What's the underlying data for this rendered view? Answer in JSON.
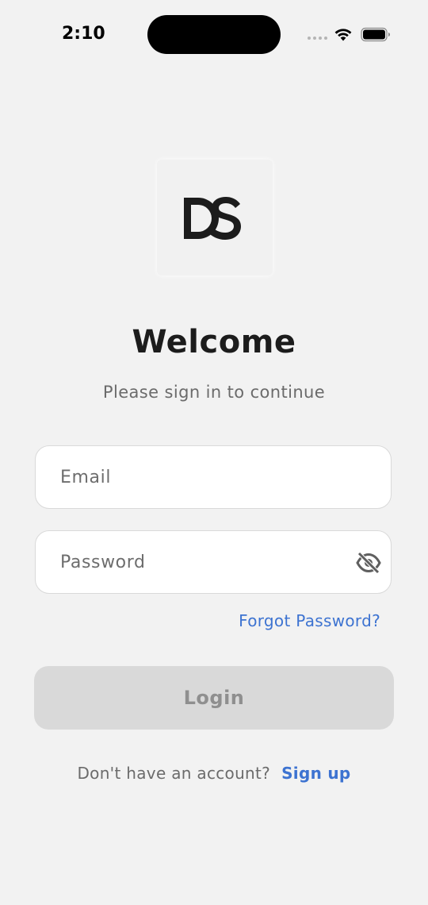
{
  "status_bar": {
    "time": "2:10"
  },
  "icons": {
    "signal": "cellular-signal-icon",
    "wifi": "wifi-icon",
    "battery": "battery-icon",
    "password_toggle": "eye-off-icon"
  },
  "logo": {
    "text": "DS",
    "color": "#1c1c1c"
  },
  "header": {
    "title": "Welcome",
    "subtitle": "Please sign in to continue"
  },
  "form": {
    "email": {
      "placeholder": "Email",
      "value": ""
    },
    "password": {
      "placeholder": "Password",
      "value": ""
    },
    "forgot_password_label": "Forgot Password?",
    "login_label": "Login",
    "login_enabled": false
  },
  "footer": {
    "prompt": "Don't have an account?",
    "signup_label": "Sign up"
  },
  "colors": {
    "background": "#f2f2f2",
    "accent": "#3d73d1",
    "disabled_button": "#d9d9d9",
    "disabled_text": "#8f8f8f"
  }
}
